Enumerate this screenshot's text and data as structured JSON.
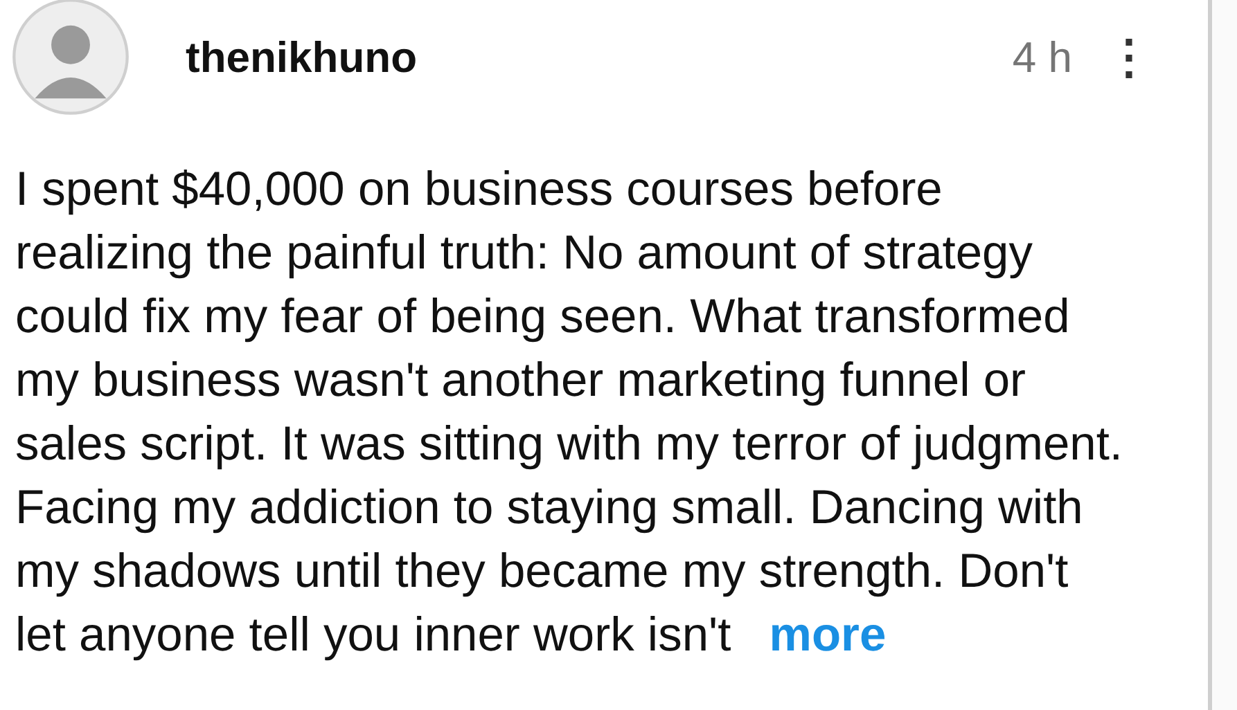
{
  "post": {
    "username": "thenikhuno",
    "time": "4 h",
    "menu_icon": "⋮",
    "body": "I spent $40,000 on business courses before realizing the painful truth: No amount of strategy could fix my fear of being seen. What transformed my business wasn't another marketing funnel or sales script. It was sitting with my terror of judgment. Facing my addiction to staying small. Dancing with my shadows until they became my strength. Don't let anyone tell you inner work isn't",
    "more_link": "more"
  }
}
